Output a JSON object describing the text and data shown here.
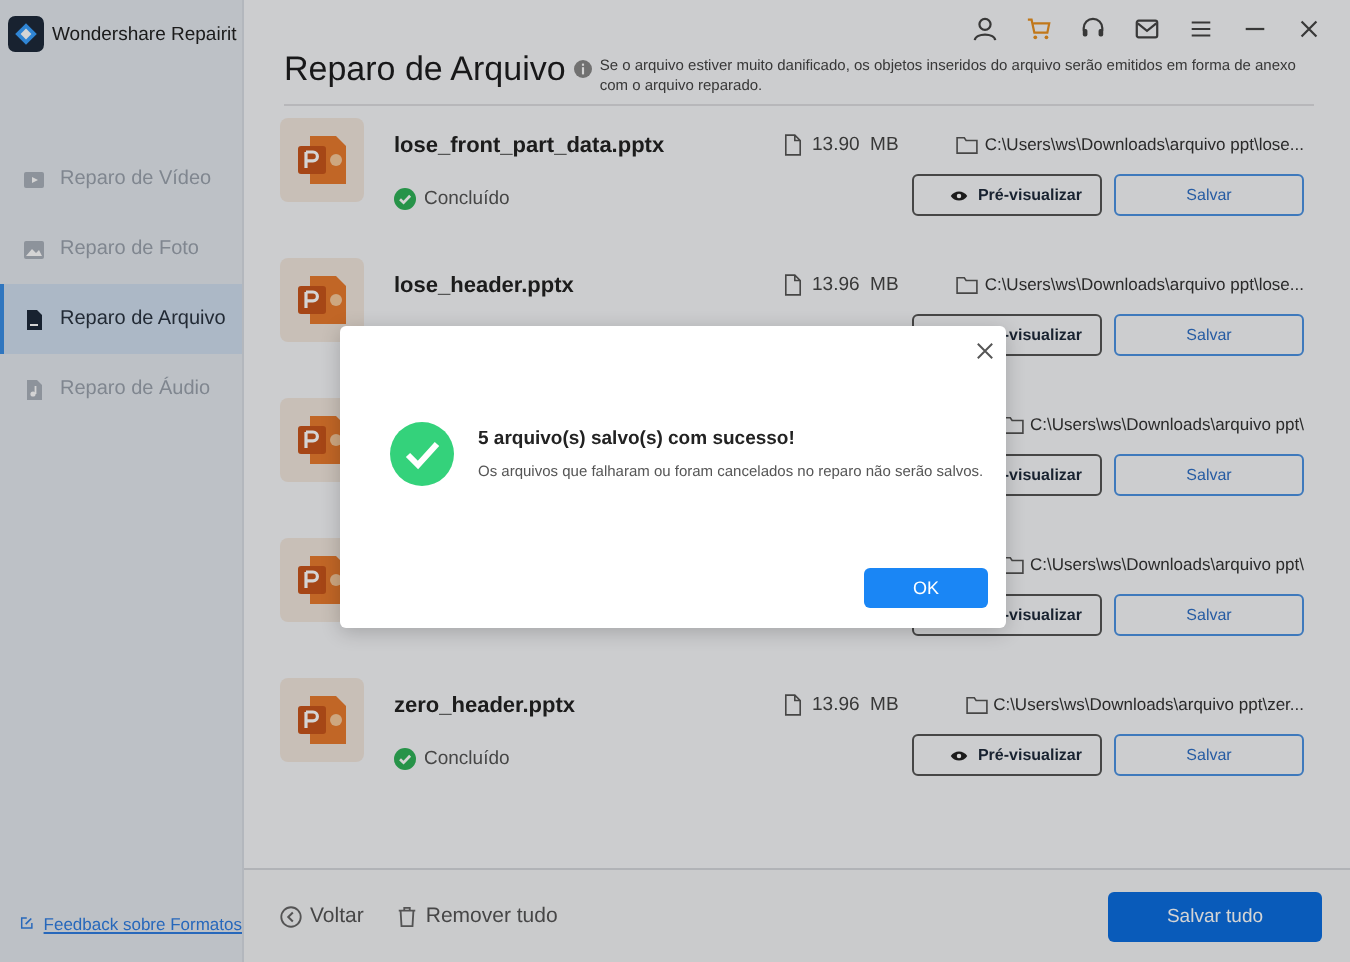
{
  "app": {
    "title": "Wondershare Repairit"
  },
  "sidebar": {
    "items": [
      {
        "label": "Reparo de Vídeo",
        "kind": "video",
        "selected": false
      },
      {
        "label": "Reparo de Foto",
        "kind": "photo",
        "selected": false
      },
      {
        "label": "Reparo de Arquivo",
        "kind": "file",
        "selected": true
      },
      {
        "label": "Reparo de Áudio",
        "kind": "audio",
        "selected": false
      }
    ],
    "feedback_link": "Feedback sobre Formatos"
  },
  "header": {
    "title": "Reparo de Arquivo",
    "note": "Se o arquivo estiver muito danificado, os objetos inseridos do arquivo serão emitidos em forma de anexo com o arquivo reparado."
  },
  "files": [
    {
      "name": "lose_front_part_data.pptx",
      "status": "Concluído",
      "size": "13.90  MB",
      "path": "C:\\Users\\ws\\Downloads\\arquivo ppt\\lose...",
      "preview": "Pré-visualizar",
      "save": "Salvar"
    },
    {
      "name": "lose_header.pptx",
      "size": "13.96  MB",
      "path": "C:\\Users\\ws\\Downloads\\arquivo ppt\\lose...",
      "preview": "-visualizar",
      "save": "Salvar"
    },
    {
      "path": "C:\\Users\\ws\\Downloads\\arquivo ppt\\",
      "preview": "-visualizar",
      "save": "Salvar"
    },
    {
      "path": "C:\\Users\\ws\\Downloads\\arquivo ppt\\",
      "preview": "-visualizar",
      "save": "Salvar"
    },
    {
      "name": "zero_header.pptx",
      "status": "Concluído",
      "size": "13.96  MB",
      "path": "C:\\Users\\ws\\Downloads\\arquivo ppt\\zer...",
      "preview": "Pré-visualizar",
      "save": "Salvar"
    }
  ],
  "footer": {
    "back": "Voltar",
    "remove_all": "Remover tudo",
    "save_all": "Salvar tudo"
  },
  "dialog": {
    "title": "5 arquivo(s) salvo(s) com sucesso!",
    "message": "Os arquivos que falharam ou foram cancelados no reparo não serão salvos.",
    "ok": "OK"
  }
}
